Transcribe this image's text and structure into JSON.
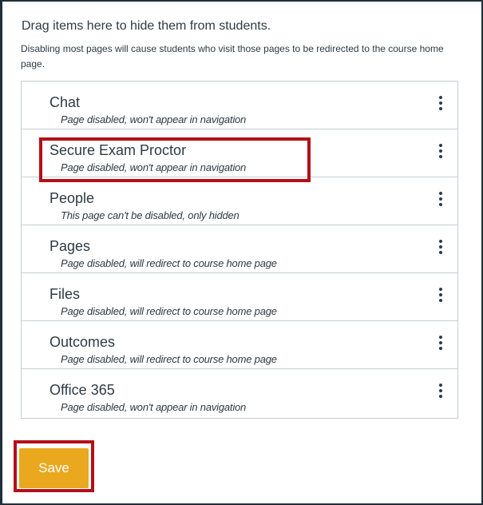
{
  "instructions": {
    "heading": "Drag items here to hide them from students.",
    "note": "Disabling most pages will cause students who visit those pages to be redirected to the course home page."
  },
  "hidden_items": [
    {
      "title": "Chat",
      "status": "Page disabled, won't appear in navigation",
      "highlighted": false
    },
    {
      "title": "Secure Exam Proctor",
      "status": "Page disabled, won't appear in navigation",
      "highlighted": true
    },
    {
      "title": "People",
      "status": "This page can't be disabled, only hidden",
      "highlighted": false
    },
    {
      "title": "Pages",
      "status": "Page disabled, will redirect to course home page",
      "highlighted": false
    },
    {
      "title": "Files",
      "status": "Page disabled, will redirect to course home page",
      "highlighted": false
    },
    {
      "title": "Outcomes",
      "status": "Page disabled, will redirect to course home page",
      "highlighted": false
    },
    {
      "title": "Office 365",
      "status": "Page disabled, won't appear in navigation",
      "highlighted": false
    }
  ],
  "item_menu_icon": "kebab-menu-icon",
  "save_label": "Save",
  "colors": {
    "text": "#2d3b45",
    "border": "#c7cdd1",
    "save_button": "#eaa81f",
    "highlight": "#b31018"
  }
}
